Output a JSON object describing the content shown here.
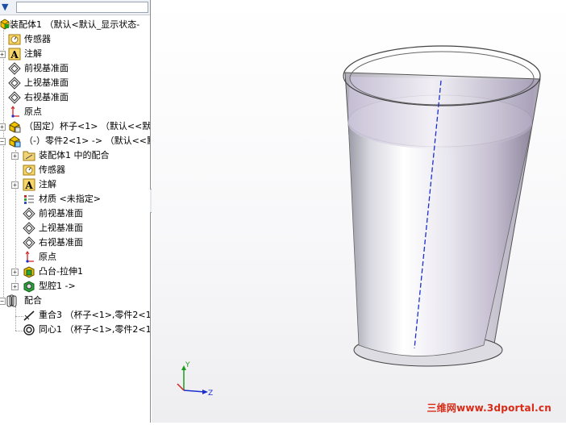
{
  "filter": {
    "icon": "filter-icon"
  },
  "tree": {
    "root": "装配体1 （默认<默认_显示状态-",
    "sensors": "传感器",
    "annotations": "注解",
    "front_plane": "前视基准面",
    "top_plane": "上视基准面",
    "right_plane": "右视基准面",
    "origin": "原点",
    "cup": "（固定）杯子<1> （默认<<默认",
    "part2": "（-）零件2<1> -> （默认<<默认",
    "part2_mates": "装配体1 中的配合",
    "part2_sensors": "传感器",
    "part2_annotations": "注解",
    "part2_material": "材质 <未指定>",
    "part2_front_plane": "前视基准面",
    "part2_top_plane": "上视基准面",
    "part2_right_plane": "右视基准面",
    "part2_origin": "原点",
    "part2_boss": "凸台-拉伸1",
    "part2_cavity": "型腔1 ->",
    "mates": "配合",
    "mate1": "重合3 （杯子<1>,零件2<1>",
    "mate2": "同心1 （杯子<1>,零件2<1>"
  },
  "viewport": {
    "triad": {
      "y_label": "Y",
      "z_label": "Z"
    },
    "watermark": "三维网www.3dportal.cn",
    "colors": {
      "axis_blue": "#1a2fcf",
      "triad_y": "#1f9a1f",
      "triad_x": "#d02020",
      "watermark": "#d92a16"
    }
  }
}
